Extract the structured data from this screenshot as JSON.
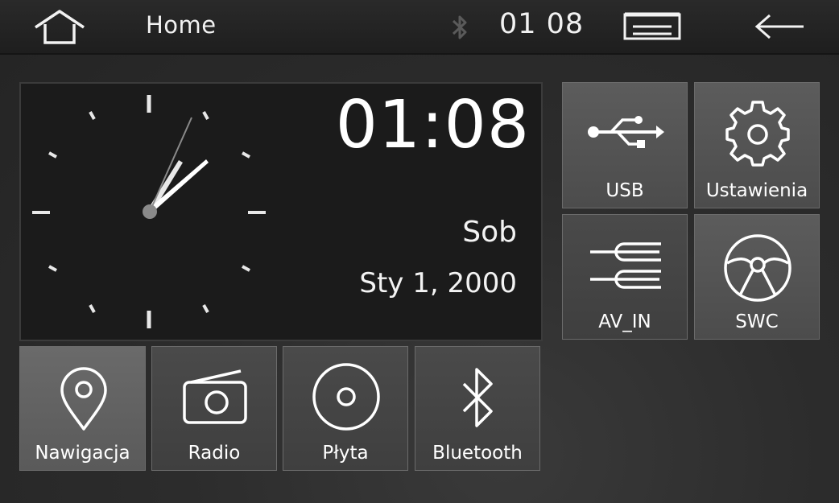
{
  "topbar": {
    "title": "Home",
    "time": "01 08",
    "icons": [
      "home-icon",
      "bluetooth-icon",
      "menu-icon",
      "back-arrow-icon"
    ]
  },
  "clock": {
    "digital_time": "01:08",
    "day": "Sob",
    "date": "Sty 1, 2000"
  },
  "tiles": {
    "usb": {
      "label": "USB",
      "icon": "usb-icon"
    },
    "settings": {
      "label": "Ustawienia",
      "icon": "gear-icon"
    },
    "av_in": {
      "label": "AV_IN",
      "icon": "av-input-icon"
    },
    "swc": {
      "label": "SWC",
      "icon": "steering-wheel-icon"
    },
    "navigation": {
      "label": "Nawigacja",
      "icon": "location-pin-icon"
    },
    "radio": {
      "label": "Radio",
      "icon": "radio-icon"
    },
    "disc": {
      "label": "Płyta",
      "icon": "disc-icon"
    },
    "bluetooth": {
      "label": "Bluetooth",
      "icon": "bluetooth-icon"
    }
  },
  "colors": {
    "background": "#2b2b2b",
    "topbar": "#1e1e1e",
    "clock_panel": "#1b1b1b",
    "tile": "#555555",
    "text": "#ffffff"
  }
}
